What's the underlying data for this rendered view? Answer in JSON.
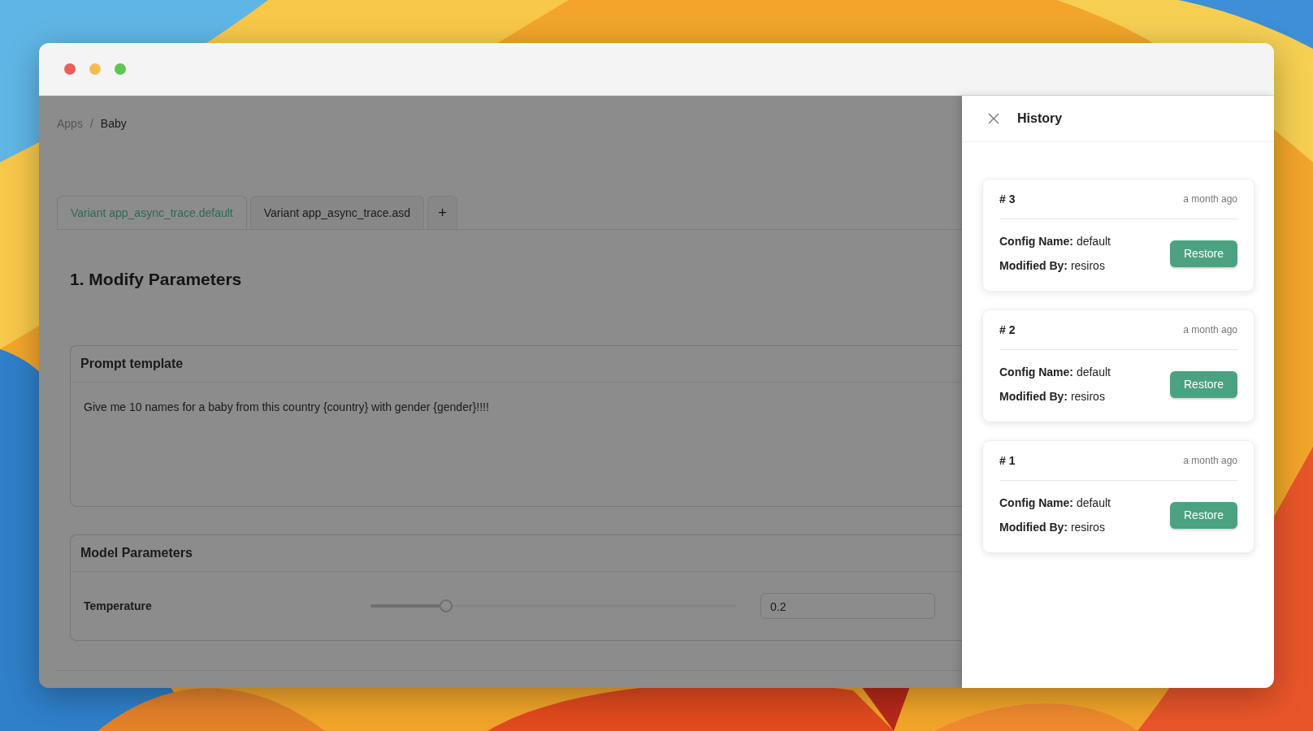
{
  "window": {
    "breadcrumb": [
      {
        "label": "Apps",
        "current": false
      },
      {
        "label": "Baby",
        "current": true
      }
    ],
    "breadcrumb_separator": "/",
    "tabs": [
      {
        "label": "Variant app_async_trace.default",
        "selected": true
      },
      {
        "label": "Variant app_async_trace.asd",
        "selected": false
      }
    ],
    "add_tab": "+",
    "heading": "1. Modify Parameters",
    "prompt_card": {
      "title": "Prompt template",
      "text": "Give me 10 names for a baby from this country {country} with gender {gender}!!!!"
    },
    "model_card": {
      "title": "Model Parameters",
      "params": [
        {
          "label": "Temperature",
          "level": 0.2,
          "value": "0.2"
        }
      ]
    }
  },
  "history": {
    "title": "History",
    "entries": [
      {
        "number": "# 3",
        "time": "a month ago",
        "fields": [
          {
            "label": "Config Name:",
            "value": "default"
          },
          {
            "label": "Modified By:",
            "value": "resiros"
          }
        ],
        "button": "Restore"
      },
      {
        "number": "# 2",
        "time": "a month ago",
        "fields": [
          {
            "label": "Config Name:",
            "value": "default"
          },
          {
            "label": "Modified By:",
            "value": "resiros"
          }
        ],
        "button": "Restore"
      },
      {
        "number": "# 1",
        "time": "a month ago",
        "fields": [
          {
            "label": "Config Name:",
            "value": "default"
          },
          {
            "label": "Modified By:",
            "value": "resiros"
          }
        ],
        "button": "Restore"
      }
    ]
  }
}
